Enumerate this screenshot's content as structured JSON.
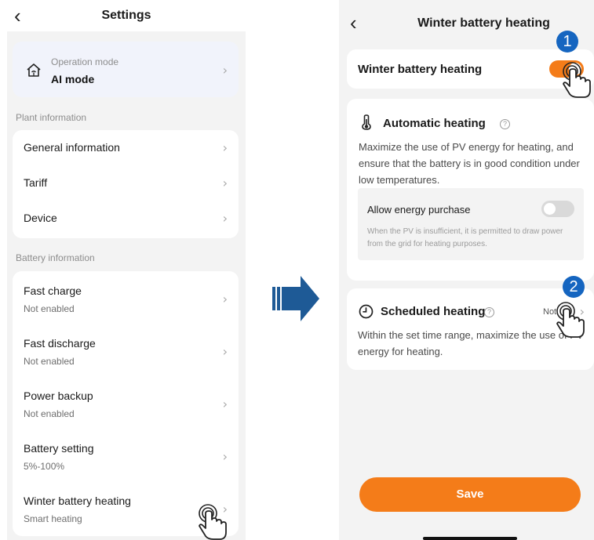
{
  "left": {
    "header": {
      "back_icon": "back-arrow-icon",
      "title": "Settings"
    },
    "operation_mode": {
      "icon": "smart-home-icon",
      "label": "Operation mode",
      "value": "AI mode"
    },
    "plant_section": {
      "label": "Plant information",
      "items": [
        {
          "label": "General information"
        },
        {
          "label": "Tariff"
        },
        {
          "label": "Device"
        }
      ]
    },
    "battery_section": {
      "label": "Battery information",
      "items": [
        {
          "label": "Fast charge",
          "status": "Not enabled"
        },
        {
          "label": "Fast discharge",
          "status": "Not enabled"
        },
        {
          "label": "Power backup",
          "status": "Not enabled"
        },
        {
          "label": "Battery setting",
          "status": "5%-100%"
        },
        {
          "label": "Winter battery heating",
          "status": "Smart heating"
        }
      ]
    }
  },
  "right": {
    "header": {
      "back_icon": "back-arrow-icon",
      "title": "Winter battery heating"
    },
    "master_toggle": {
      "label": "Winter battery heating",
      "on": true
    },
    "automatic": {
      "icon": "thermometer-icon",
      "title": "Automatic heating",
      "description": "Maximize the use of PV energy for heating, and ensure that the battery is in good condition under low temperatures.",
      "energy_purchase": {
        "label": "Allow energy purchase",
        "on": false,
        "note": "When the PV is insufficient, it is permitted to draw power from the grid for heating purposes."
      }
    },
    "scheduled": {
      "icon": "clock-icon",
      "title": "Scheduled heating",
      "state": "Not",
      "description": "Within the set time range, maximize the use of PV energy for heating."
    },
    "save_label": "Save"
  },
  "annotations": {
    "step1": "1",
    "step2": "2",
    "accent_color": "#f47c19",
    "badge_color": "#1565c0"
  }
}
